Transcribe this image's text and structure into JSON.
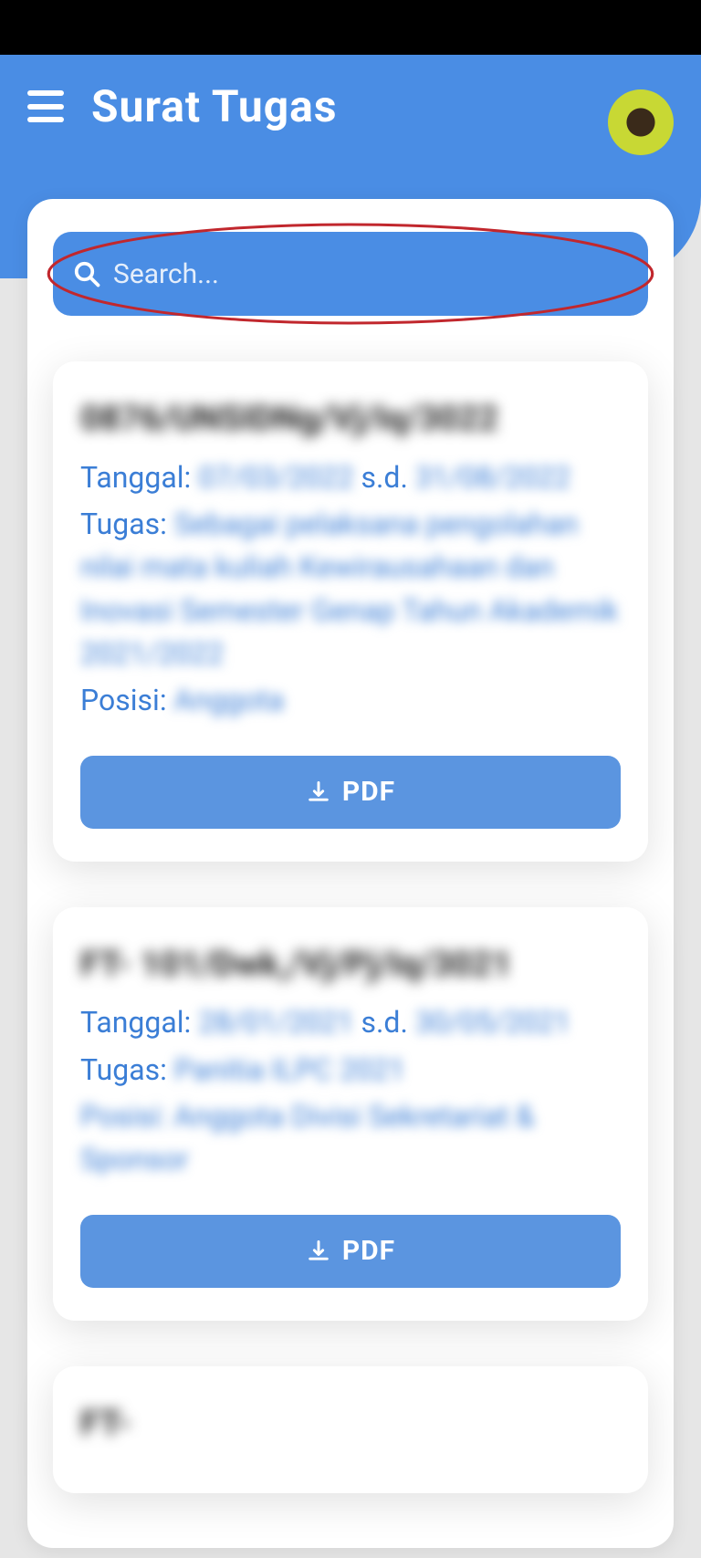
{
  "header": {
    "title": "Surat Tugas"
  },
  "search": {
    "placeholder": "Search..."
  },
  "labels": {
    "tanggal": "Tanggal:",
    "sd": "s.d.",
    "tugas": "Tugas:",
    "posisi": "Posisi:",
    "pdf": "PDF"
  },
  "cards": [
    {
      "nomor": "0876/UNSIDNg/Vj/Iq/3022",
      "tgl_mulai": "07/03/2022",
      "tgl_selesai": "31/08/2022",
      "tugas": "Sebagai pelaksana pengolahan nilai mata kuliah Kewirausahaan dan Inovasi Semester Genap Tahun Akademik 2021/2022",
      "posisi": "Anggota"
    },
    {
      "nomor": "FT- 101/Dwk,/Vj/Pj/Iq/3021",
      "tgl_mulai": "28/01/2021",
      "tgl_selesai": "30/05/2021",
      "tugas": "Panitia ILPC 2021",
      "posisi_line": "Posisi: Anggota Divisi Sekretariat & Sponsor"
    },
    {
      "nomor": "FT-"
    }
  ]
}
